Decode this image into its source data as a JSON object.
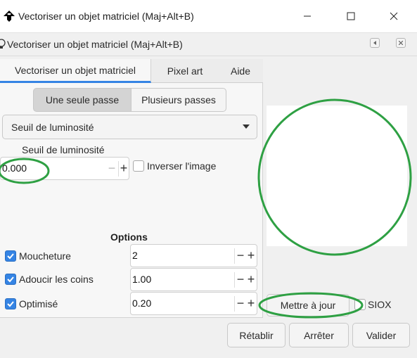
{
  "window": {
    "title": "Vectoriser un objet matriciel (Maj+Alt+B)"
  },
  "dock": {
    "title": "Vectoriser un objet matriciel (Maj+Alt+B)"
  },
  "tabs": [
    {
      "label": "Vectoriser un objet matriciel",
      "active": true
    },
    {
      "label": "Pixel art",
      "active": false
    },
    {
      "label": "Aide",
      "active": false
    }
  ],
  "mode": {
    "single_label": "Une seule passe",
    "multi_label": "Plusieurs passes",
    "selected": "single"
  },
  "detection": {
    "selected": "Seuil de luminosité"
  },
  "threshold": {
    "label": "Seuil de luminosité",
    "value": "0.000",
    "minus": "−",
    "plus": "+"
  },
  "invert": {
    "label": "Inverser l'image",
    "checked": false
  },
  "options": {
    "title": "Options",
    "items": [
      {
        "label": "Moucheture",
        "value": "2",
        "checked": true
      },
      {
        "label": "Adoucir les coins",
        "value": "1.00",
        "checked": true
      },
      {
        "label": "Optimisé",
        "value": "0.20",
        "checked": true
      }
    ]
  },
  "preview": {
    "update_label": "Mettre à jour"
  },
  "siox": {
    "label": "SIOX",
    "checked": false
  },
  "buttons": {
    "reset": "Rétablir",
    "stop": "Arrêter",
    "ok": "Valider"
  },
  "colors": {
    "accent": "#3584e4",
    "annotation": "#2ea043"
  },
  "icons": {
    "app": "inkscape-logo-icon",
    "dock": "bulb-icon",
    "minimize": "minimize-icon",
    "maximize": "maximize-icon",
    "close": "close-icon",
    "dropdown": "chevron-down-icon",
    "check": "check-icon"
  }
}
